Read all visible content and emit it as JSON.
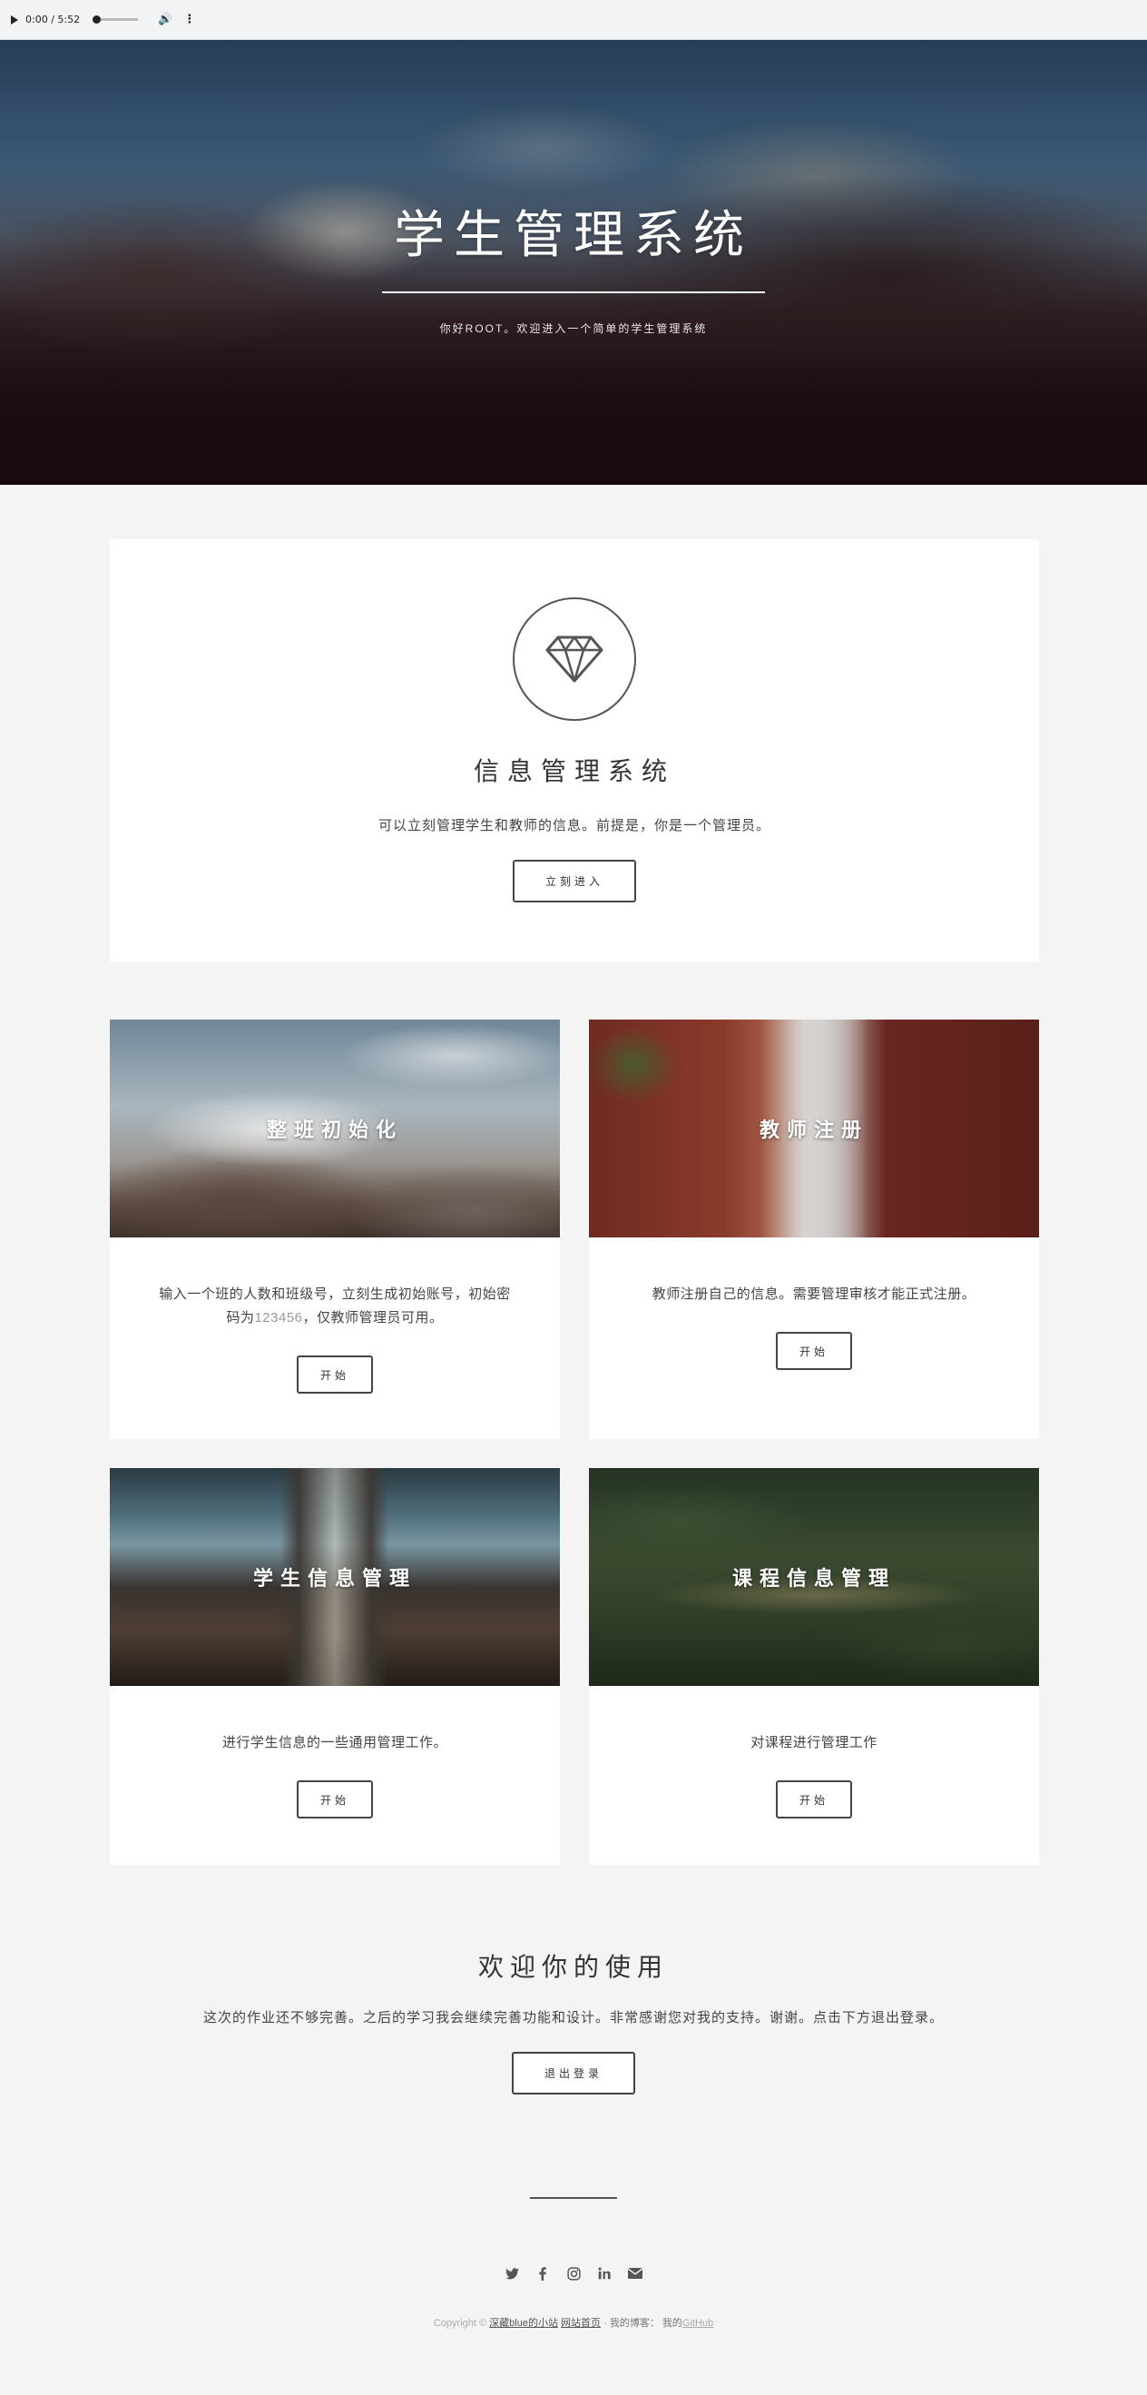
{
  "audio": {
    "time": "0:00 / 5:52",
    "progress": 0
  },
  "hero": {
    "title": "学生管理系统",
    "subtitle": "你好ROOT。欢迎进入一个简单的学生管理系统"
  },
  "intro": {
    "icon": "diamond-icon",
    "title": "信息管理系统",
    "description": "可以立刻管理学生和教师的信息。前提是，你是一个管理员。",
    "button": "立刻进入"
  },
  "cards": [
    {
      "title": "整班初始化",
      "description_before": "输入一个班的人数和班级号，立刻生成初始账号，初始密码为",
      "description_highlight": "123456",
      "description_after": "，仅教师管理员可用。",
      "button": "开始"
    },
    {
      "title": "教师注册",
      "description": "教师注册自己的信息。需要管理审核才能正式注册。",
      "button": "开始"
    },
    {
      "title": "学生信息管理",
      "description": "进行学生信息的一些通用管理工作。",
      "button": "开始"
    },
    {
      "title": "课程信息管理",
      "description": "对课程进行管理工作",
      "button": "开始"
    }
  ],
  "welcome": {
    "title": "欢迎你的使用",
    "description": "这次的作业还不够完善。之后的学习我会继续完善功能和设计。非常感谢您对我的支持。谢谢。点击下方退出登录。",
    "button": "退出登录"
  },
  "footer": {
    "socials": [
      "twitter-icon",
      "facebook-icon",
      "instagram-icon",
      "linkedin-icon",
      "email-icon"
    ],
    "copyright_prefix": "Copyright ©",
    "site_name": "深藏blue的小站",
    "home_link": "网站首页",
    "blog_label": "· 我的博客：",
    "github_prefix": "我的",
    "github_link": "GitHub"
  },
  "colors": {
    "page_bg": "#f4f4f4",
    "card_bg": "#ffffff",
    "text": "#444444",
    "button_border": "#444444"
  }
}
